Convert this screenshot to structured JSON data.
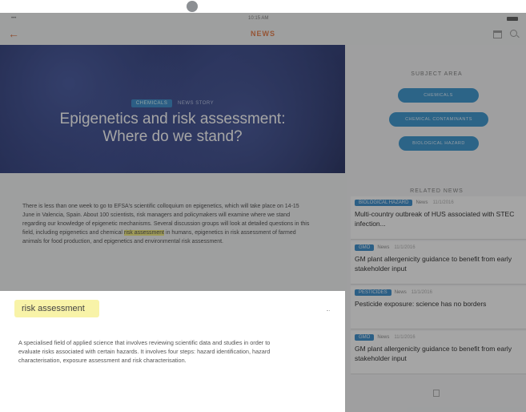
{
  "status": {
    "carrier": "•••",
    "time": "10:15 AM"
  },
  "nav": {
    "title": "NEWS",
    "back_glyph": "←"
  },
  "hero": {
    "tag": "CHEMICALS",
    "meta": "NEWS STORY",
    "title_line1": "Epigenetics and risk assessment:",
    "title_line2": "Where do we stand?"
  },
  "article": {
    "text_before": "There is less than one week to go to EFSA's scientific colloquium on epigenetics, which will take place on 14-15 June in Valencia, Spain. About 100 scientists, risk managers and policymakers will examine where we stand regarding our knowledge of epigenetic mechanisms. Several discussion groups will look at detailed questions in this field, including epigenetics and chemical",
    "highlight": "risk assessment",
    "text_after": "in humans, epigenetics in risk assessment of farmed animals for food production, and epigenetics and environmental risk assessment."
  },
  "subject_area": {
    "title": "SUBJECT AREA",
    "pills": [
      "CHEMICALS",
      "CHEMICAL CONTAMINANTS",
      "BIOLOGICAL HAZARD"
    ]
  },
  "related": {
    "title": "RELATED NEWS",
    "items": [
      {
        "tag": "BIOLOGICAL HAZARD",
        "type": "News",
        "time": "11/1/2016",
        "title": "Multi-country outbreak of HUS associated with STEC infection..."
      },
      {
        "tag": "GMO",
        "type": "News",
        "time": "11/1/2016",
        "title": "GM plant allergenicity guidance to benefit from early stakeholder input"
      },
      {
        "tag": "PESTICIDES",
        "type": "News",
        "time": "11/1/2016",
        "title": "Pesticide exposure: science has no borders"
      },
      {
        "tag": "GMO",
        "type": "News",
        "time": "11/1/2016",
        "title": "GM plant allergenicity guidance to benefit from early stakeholder input"
      }
    ]
  },
  "popup": {
    "term": "risk assessment",
    "definition": "A specialised field of applied science that involves reviewing scientific data and studies in order to evaluate risks associated with certain hazards. It involves four steps: hazard identification, hazard characterisation, exposure assessment and risk characterisation."
  }
}
